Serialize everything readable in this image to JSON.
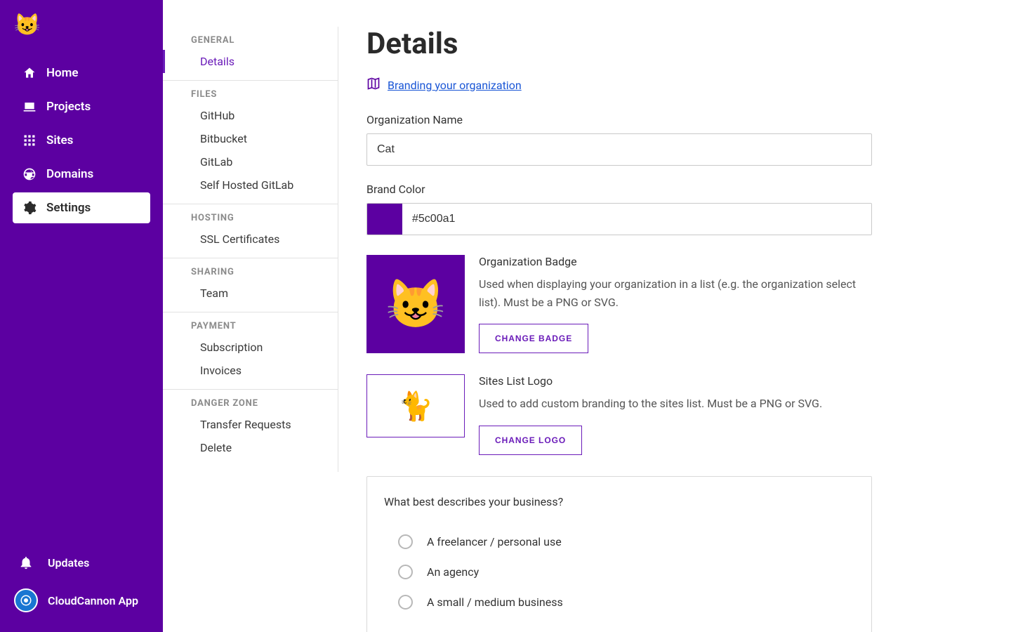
{
  "sidebar": {
    "nav": [
      {
        "label": "Home"
      },
      {
        "label": "Projects"
      },
      {
        "label": "Sites"
      },
      {
        "label": "Domains"
      },
      {
        "label": "Settings"
      }
    ],
    "bottom": {
      "updates": "Updates",
      "app": "CloudCannon App"
    }
  },
  "subnav": {
    "sections": [
      {
        "header": "GENERAL",
        "items": [
          "Details"
        ]
      },
      {
        "header": "FILES",
        "items": [
          "GitHub",
          "Bitbucket",
          "GitLab",
          "Self Hosted GitLab"
        ]
      },
      {
        "header": "HOSTING",
        "items": [
          "SSL Certificates"
        ]
      },
      {
        "header": "SHARING",
        "items": [
          "Team"
        ]
      },
      {
        "header": "PAYMENT",
        "items": [
          "Subscription",
          "Invoices"
        ]
      },
      {
        "header": "DANGER ZONE",
        "items": [
          "Transfer Requests",
          "Delete"
        ]
      }
    ]
  },
  "page": {
    "title": "Details",
    "helpLink": "Branding your organization",
    "orgNameLabel": "Organization Name",
    "orgNameValue": "Cat",
    "brandColorLabel": "Brand Color",
    "brandColorValue": "#5c00a1",
    "badge": {
      "title": "Organization Badge",
      "desc": "Used when displaying your organization in a list (e.g. the organization select list). Must be a PNG or SVG.",
      "button": "CHANGE BADGE"
    },
    "logo": {
      "title": "Sites List Logo",
      "desc": "Used to add custom branding to the sites list. Must be a PNG or SVG.",
      "button": "CHANGE LOGO"
    },
    "question": {
      "title": "What best describes your business?",
      "options": [
        "A freelancer / personal use",
        "An agency",
        "A small / medium business"
      ]
    }
  }
}
